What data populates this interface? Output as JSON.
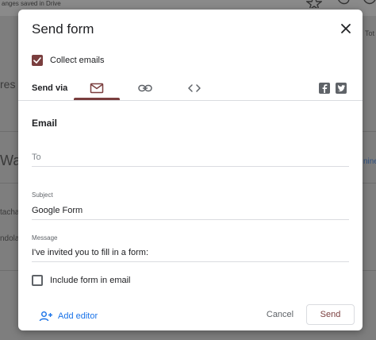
{
  "background": {
    "top_status": "anges saved in Drive",
    "top_right_text": "Tot",
    "left_snippet_1": "res",
    "left_snippet_2": "Wa",
    "left_snippet_3": "tacha",
    "left_snippet_4": "ndola",
    "right_snippet": "nine"
  },
  "dialog": {
    "title": "Send form",
    "collect_emails_label": "Collect emails",
    "collect_emails_checked": true,
    "send_via_label": "Send via",
    "tabs": [
      {
        "name": "email",
        "icon": "mail-icon",
        "selected": true
      },
      {
        "name": "link",
        "icon": "link-icon",
        "selected": false
      },
      {
        "name": "embed",
        "icon": "code-icon",
        "selected": false
      }
    ],
    "social": [
      "facebook-icon",
      "twitter-icon"
    ],
    "section_title": "Email",
    "to_placeholder": "To",
    "to_value": "",
    "subject_label": "Subject",
    "subject_value": "Google Form",
    "message_label": "Message",
    "message_value": "I've invited you to fill in a form:",
    "include_form_label": "Include form in email",
    "include_form_checked": false,
    "add_editor_label": "Add editor",
    "cancel_label": "Cancel",
    "send_label": "Send"
  },
  "colors": {
    "accent": "#7a3e3e",
    "link_blue": "#1a73e8",
    "text": "#202124",
    "muted": "#5f6368"
  }
}
